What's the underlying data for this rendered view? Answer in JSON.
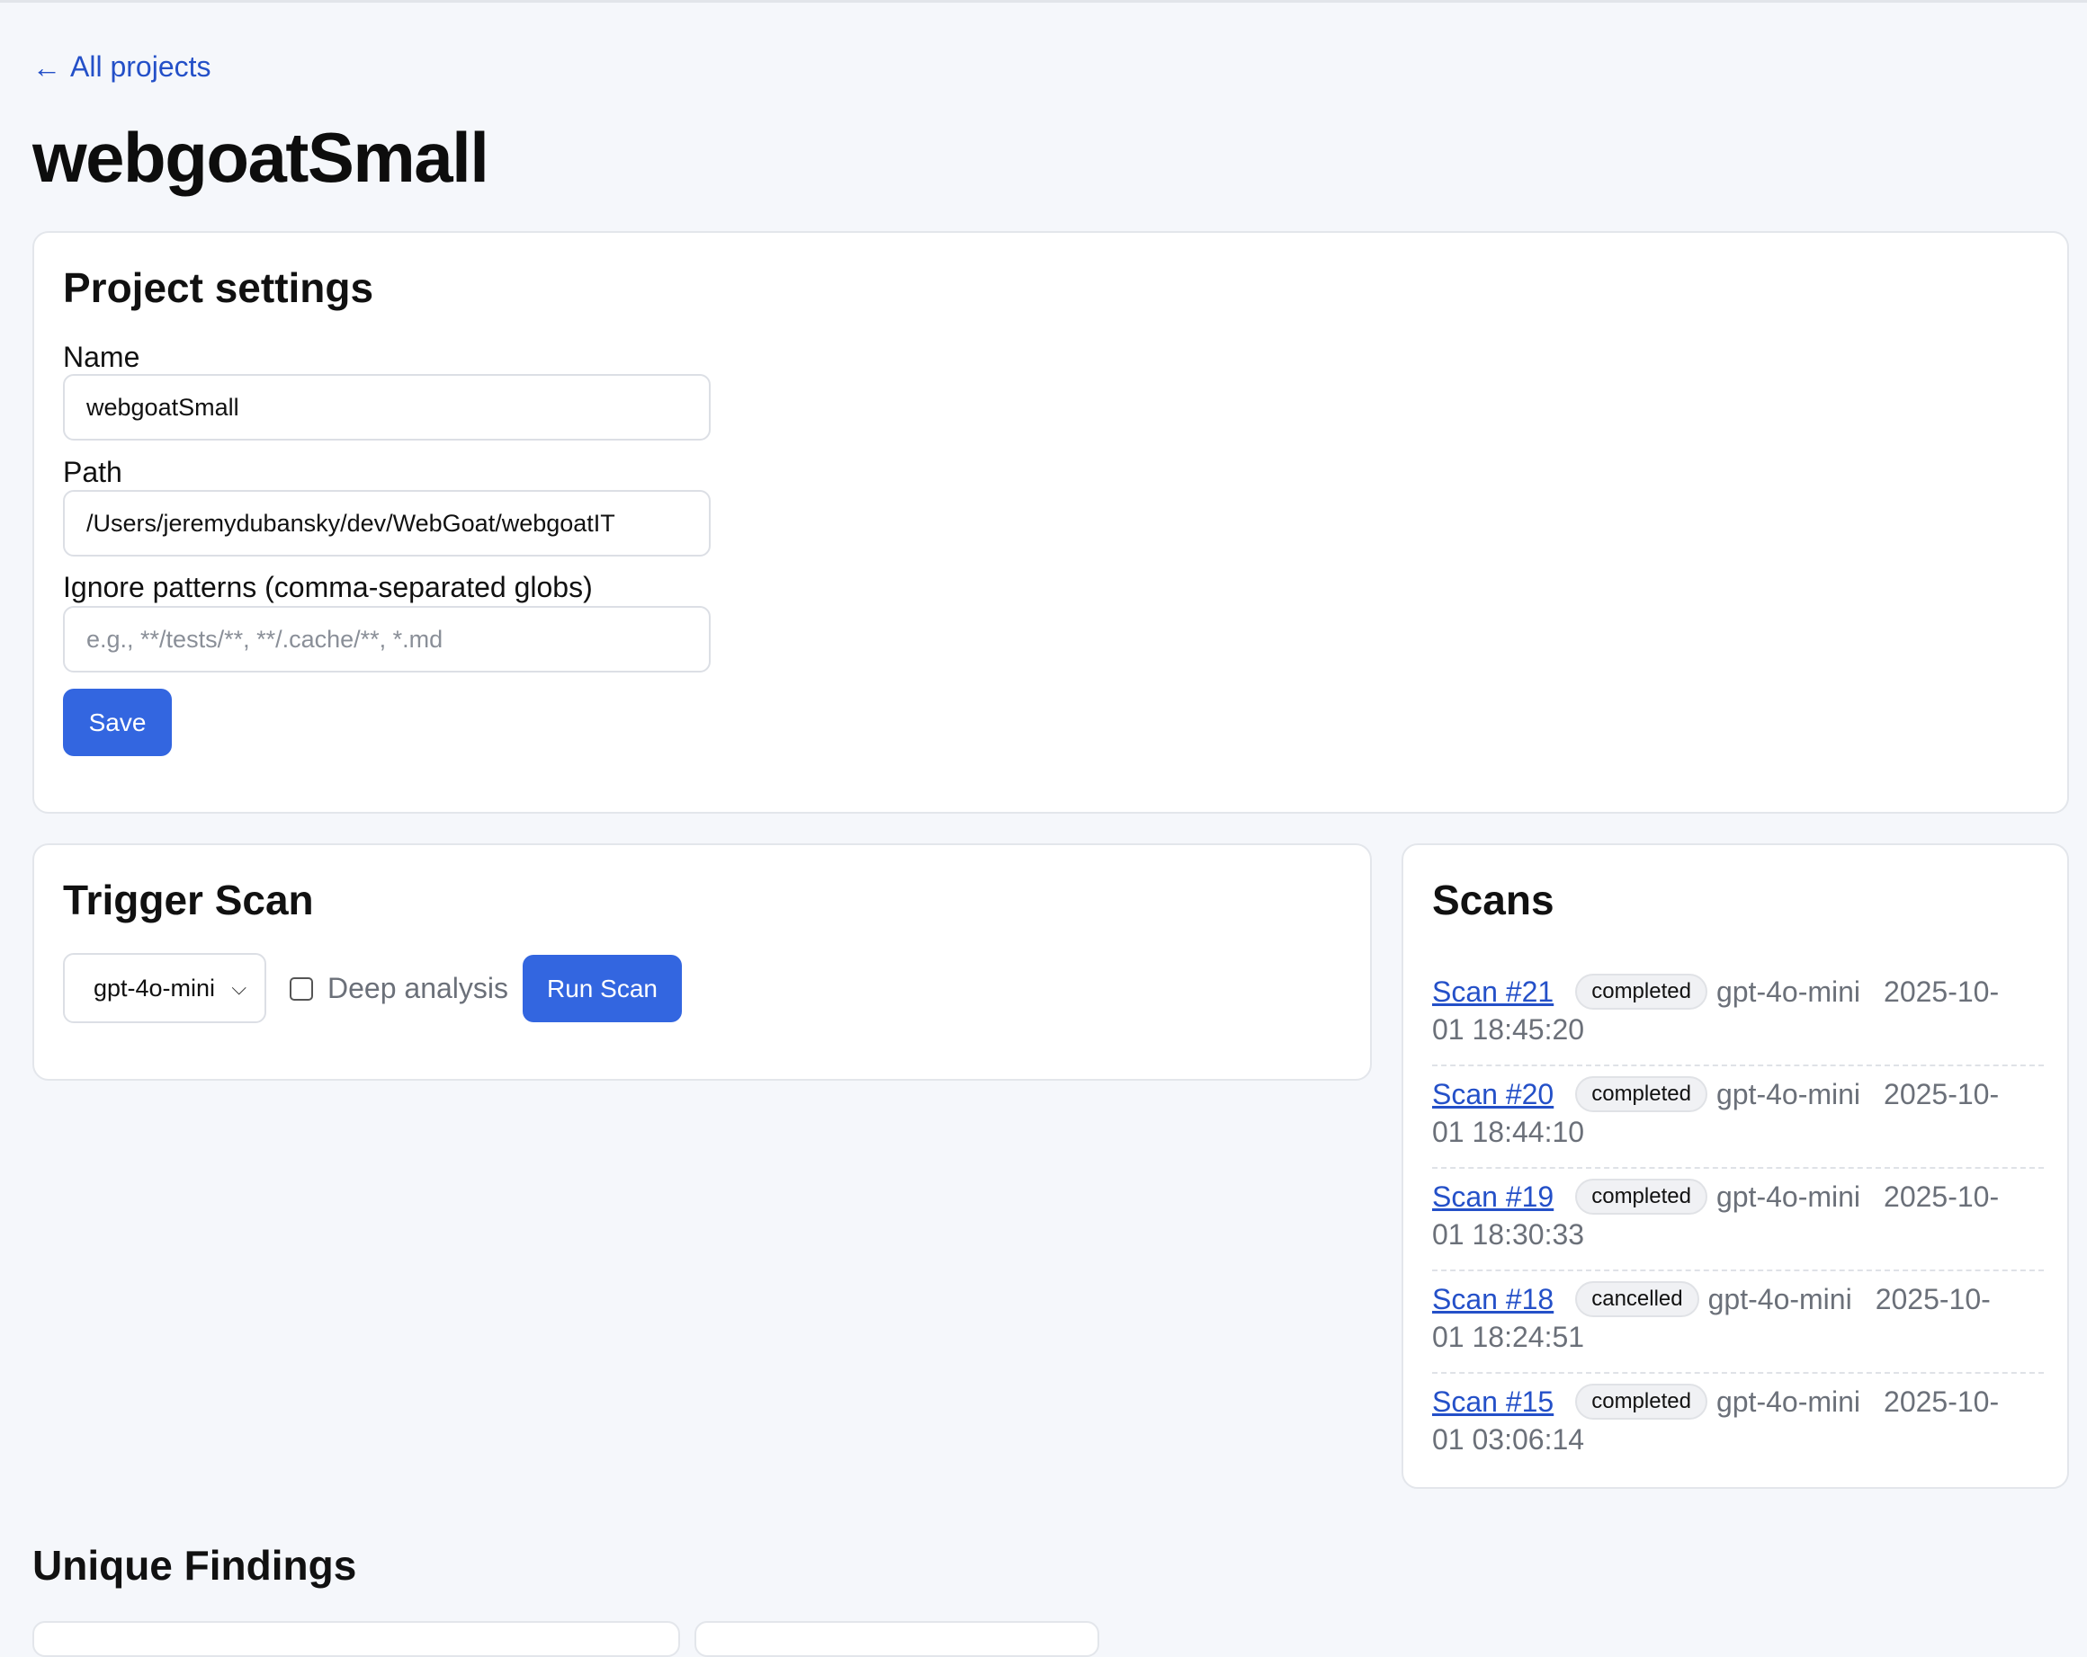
{
  "nav": {
    "back_arrow": "←",
    "back_label": "All projects"
  },
  "project": {
    "title": "webgoatSmall"
  },
  "settings": {
    "heading": "Project settings",
    "name_label": "Name",
    "name_value": "webgoatSmall",
    "path_label": "Path",
    "path_value": "/Users/jeremydubansky/dev/WebGoat/webgoatIT",
    "ignore_label": "Ignore patterns (comma-separated globs)",
    "ignore_value": "",
    "ignore_placeholder": "e.g., **/tests/**, **/.cache/**, *.md",
    "save_label": "Save"
  },
  "trigger": {
    "heading": "Trigger Scan",
    "model_selected": "gpt-4o-mini",
    "deep_label": "Deep analysis",
    "deep_checked": false,
    "run_label": "Run Scan"
  },
  "scans": {
    "heading": "Scans",
    "items": [
      {
        "label": "Scan #21",
        "status": "completed",
        "model": "gpt-4o-mini",
        "date_part1": "2025-10-",
        "date_part2": "01 18:45:20"
      },
      {
        "label": "Scan #20",
        "status": "completed",
        "model": "gpt-4o-mini",
        "date_part1": "2025-10-",
        "date_part2": "01 18:44:10"
      },
      {
        "label": "Scan #19",
        "status": "completed",
        "model": "gpt-4o-mini",
        "date_part1": "2025-10-",
        "date_part2": "01 18:30:33"
      },
      {
        "label": "Scan #18",
        "status": "cancelled",
        "model": "gpt-4o-mini",
        "date_part1": "2025-10-",
        "date_part2": "01 18:24:51"
      },
      {
        "label": "Scan #15",
        "status": "completed",
        "model": "gpt-4o-mini",
        "date_part1": "2025-10-",
        "date_part2": "01 03:06:14"
      }
    ]
  },
  "findings": {
    "heading": "Unique Findings"
  },
  "colors": {
    "accent": "#3366e0",
    "link": "#2450c8",
    "muted_text": "#6b7079",
    "background": "#f5f7fb"
  },
  "icons": {
    "back": "arrow-left-icon",
    "select": "chevron-down-icon"
  }
}
